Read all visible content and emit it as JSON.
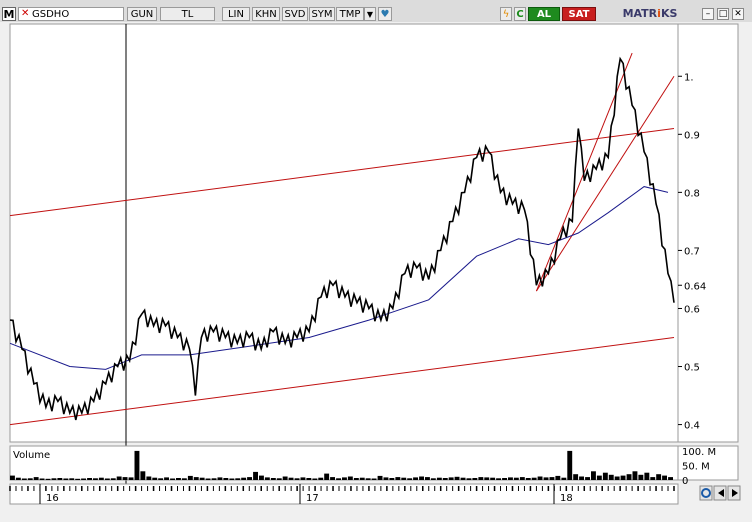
{
  "toolbar": {
    "menu_label": "M",
    "symbol": "GSDHO",
    "buttons": [
      {
        "label": "GUN"
      },
      {
        "label": "TL"
      },
      {
        "label": "LIN"
      },
      {
        "label": "KHN"
      },
      {
        "label": "SVD"
      },
      {
        "label": "SYM"
      },
      {
        "label": "TMP"
      }
    ],
    "buy_label": "AL",
    "sell_label": "SAT",
    "logo_prefix": "MATR",
    "logo_mark": "i",
    "logo_suffix": "KS",
    "refresh_label": "C"
  },
  "colors": {
    "price": "#000000",
    "moving_average": "#1a1a8c",
    "trend_lines": "#c01010",
    "volume": "#000000",
    "background": "#ffffff"
  },
  "chart_data": {
    "type": "line",
    "x_tick_labels": [
      "16",
      "17",
      "18"
    ],
    "y_ticks": [
      0.4,
      0.5,
      0.6,
      0.7,
      0.8,
      0.9,
      1.0
    ],
    "y_tick_labels": [
      "0.4",
      "0.5",
      "0.6",
      "0.7",
      "0.8",
      "0.9",
      "1.",
      "0.64"
    ],
    "ylim": [
      0.37,
      1.09
    ],
    "last_value": 0.64,
    "price_series": [
      {
        "x": 0,
        "y": 0.58
      },
      {
        "x": 2,
        "y": 0.53
      },
      {
        "x": 4,
        "y": 0.47
      },
      {
        "x": 6,
        "y": 0.43
      },
      {
        "x": 8,
        "y": 0.44
      },
      {
        "x": 10,
        "y": 0.42
      },
      {
        "x": 12,
        "y": 0.42
      },
      {
        "x": 14,
        "y": 0.44
      },
      {
        "x": 16,
        "y": 0.47
      },
      {
        "x": 18,
        "y": 0.5
      },
      {
        "x": 20,
        "y": 0.51
      },
      {
        "x": 22,
        "y": 0.59
      },
      {
        "x": 24,
        "y": 0.57
      },
      {
        "x": 26,
        "y": 0.57
      },
      {
        "x": 28,
        "y": 0.55
      },
      {
        "x": 30,
        "y": 0.53
      },
      {
        "x": 31,
        "y": 0.45
      },
      {
        "x": 32,
        "y": 0.55
      },
      {
        "x": 34,
        "y": 0.56
      },
      {
        "x": 36,
        "y": 0.55
      },
      {
        "x": 38,
        "y": 0.54
      },
      {
        "x": 40,
        "y": 0.55
      },
      {
        "x": 42,
        "y": 0.53
      },
      {
        "x": 44,
        "y": 0.56
      },
      {
        "x": 46,
        "y": 0.54
      },
      {
        "x": 48,
        "y": 0.55
      },
      {
        "x": 50,
        "y": 0.56
      },
      {
        "x": 52,
        "y": 0.62
      },
      {
        "x": 54,
        "y": 0.64
      },
      {
        "x": 56,
        "y": 0.62
      },
      {
        "x": 58,
        "y": 0.61
      },
      {
        "x": 60,
        "y": 0.6
      },
      {
        "x": 62,
        "y": 0.58
      },
      {
        "x": 64,
        "y": 0.6
      },
      {
        "x": 66,
        "y": 0.66
      },
      {
        "x": 68,
        "y": 0.67
      },
      {
        "x": 70,
        "y": 0.65
      },
      {
        "x": 72,
        "y": 0.7
      },
      {
        "x": 74,
        "y": 0.75
      },
      {
        "x": 76,
        "y": 0.8
      },
      {
        "x": 78,
        "y": 0.86
      },
      {
        "x": 80,
        "y": 0.87
      },
      {
        "x": 82,
        "y": 0.8
      },
      {
        "x": 84,
        "y": 0.78
      },
      {
        "x": 86,
        "y": 0.77
      },
      {
        "x": 88,
        "y": 0.64
      },
      {
        "x": 90,
        "y": 0.66
      },
      {
        "x": 92,
        "y": 0.72
      },
      {
        "x": 94,
        "y": 0.75
      },
      {
        "x": 95,
        "y": 0.91
      },
      {
        "x": 96,
        "y": 0.82
      },
      {
        "x": 98,
        "y": 0.84
      },
      {
        "x": 100,
        "y": 0.86
      },
      {
        "x": 102,
        "y": 1.03
      },
      {
        "x": 104,
        "y": 0.95
      },
      {
        "x": 106,
        "y": 0.87
      },
      {
        "x": 108,
        "y": 0.78
      },
      {
        "x": 110,
        "y": 0.66
      },
      {
        "x": 111,
        "y": 0.61
      }
    ],
    "moving_average": [
      {
        "x": 0,
        "y": 0.54
      },
      {
        "x": 10,
        "y": 0.5
      },
      {
        "x": 16,
        "y": 0.495
      },
      {
        "x": 22,
        "y": 0.52
      },
      {
        "x": 30,
        "y": 0.52
      },
      {
        "x": 40,
        "y": 0.535
      },
      {
        "x": 50,
        "y": 0.55
      },
      {
        "x": 60,
        "y": 0.58
      },
      {
        "x": 70,
        "y": 0.615
      },
      {
        "x": 78,
        "y": 0.69
      },
      {
        "x": 85,
        "y": 0.72
      },
      {
        "x": 90,
        "y": 0.71
      },
      {
        "x": 95,
        "y": 0.73
      },
      {
        "x": 100,
        "y": 0.765
      },
      {
        "x": 106,
        "y": 0.81
      },
      {
        "x": 110,
        "y": 0.8
      }
    ],
    "trend_lines": [
      {
        "x1": 0,
        "y1": 0.76,
        "x2": 111,
        "y2": 0.91
      },
      {
        "x1": 0,
        "y1": 0.4,
        "x2": 111,
        "y2": 0.55
      },
      {
        "x1": 88,
        "y1": 0.63,
        "x2": 104,
        "y2": 1.04
      },
      {
        "x1": 88,
        "y1": 0.63,
        "x2": 111,
        "y2": 1.0
      }
    ],
    "volume": {
      "label": "Volume",
      "tick_labels": [
        "100. M",
        "50. M",
        "0"
      ],
      "ylim": [
        0,
        110
      ],
      "values": [
        15,
        8,
        5,
        6,
        10,
        5,
        4,
        6,
        7,
        5,
        6,
        4,
        5,
        7,
        6,
        8,
        5,
        6,
        12,
        10,
        9,
        100,
        30,
        12,
        8,
        6,
        9,
        5,
        7,
        6,
        14,
        10,
        8,
        5,
        6,
        9,
        7,
        5,
        6,
        8,
        10,
        28,
        15,
        9,
        7,
        6,
        12,
        8,
        6,
        9,
        7,
        5,
        8,
        22,
        10,
        6,
        9,
        12,
        7,
        8,
        6,
        5,
        14,
        9,
        7,
        10,
        8,
        6,
        9,
        12,
        10,
        6,
        8,
        7,
        9,
        11,
        8,
        6,
        7,
        10,
        9,
        8,
        6,
        7,
        9,
        8,
        10,
        7,
        8,
        12,
        9,
        10,
        14,
        8,
        100,
        20,
        12,
        10,
        30,
        15,
        25,
        18,
        12,
        15,
        20,
        30,
        18,
        25,
        10,
        20,
        15,
        10
      ]
    }
  }
}
